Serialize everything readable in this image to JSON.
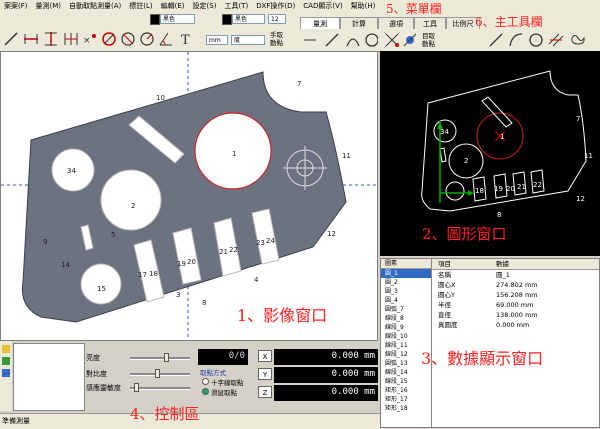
{
  "menu": [
    "案案(F)",
    "量測(M)",
    "自動取點測量(A)",
    "標註(L)",
    "編輯(E)",
    "設定(S)",
    "工具(T)",
    "DXF操作(D)",
    "CAD顯示(V)",
    "幫助(H)"
  ],
  "toolbar": {
    "color1": "黑色",
    "color2": "黑色",
    "line_width": "12",
    "unit_combo": "mm",
    "angle_combo": "度",
    "manual_pick": [
      "手取",
      "動點"
    ],
    "auto_pick": [
      "目取",
      "動點"
    ]
  },
  "tabs": [
    {
      "label": "量測",
      "active": true
    },
    {
      "label": "計算",
      "active": false
    },
    {
      "label": "選項",
      "active": false
    },
    {
      "label": "工具",
      "active": false
    },
    {
      "label": "比例尺",
      "active": false
    }
  ],
  "image_window": {
    "part_labels": [
      "1",
      "2",
      "3",
      "4",
      "5",
      "7",
      "8",
      "9",
      "10",
      "11",
      "12",
      "14",
      "15",
      "17",
      "18",
      "19",
      "20",
      "21",
      "22",
      "23",
      "24",
      "34"
    ]
  },
  "graphics_window": {
    "part_labels": [
      "1",
      "2",
      "7",
      "8",
      "11",
      "12",
      "18",
      "19",
      "20",
      "21",
      "22",
      "34"
    ]
  },
  "data_window": {
    "list_header": "圖素",
    "list_items": [
      {
        "label": "圓_1",
        "selected": true
      },
      {
        "label": "圓_2",
        "selected": false
      },
      {
        "label": "圓_3",
        "selected": false
      },
      {
        "label": "圓_4",
        "selected": false
      },
      {
        "label": "圓弧_7",
        "selected": false
      },
      {
        "label": "線段_8",
        "selected": false
      },
      {
        "label": "線段_9",
        "selected": false
      },
      {
        "label": "線段_10",
        "selected": false
      },
      {
        "label": "線段_11",
        "selected": false
      },
      {
        "label": "線段_12",
        "selected": false
      },
      {
        "label": "圓弧_13",
        "selected": false
      },
      {
        "label": "線段_14",
        "selected": false
      },
      {
        "label": "線段_15",
        "selected": false
      },
      {
        "label": "矩形_16",
        "selected": false
      },
      {
        "label": "矩形_17",
        "selected": false
      },
      {
        "label": "矩形_18",
        "selected": false
      }
    ],
    "prop_header": {
      "key": "項目",
      "value": "數據"
    },
    "props": [
      {
        "key": "名稱",
        "value": "圓_1"
      },
      {
        "key": "圓心X",
        "value": "274.802 mm"
      },
      {
        "key": "圓心Y",
        "value": "156.208 mm"
      },
      {
        "key": "半徑",
        "value": "69.000 mm"
      },
      {
        "key": "直徑",
        "value": "138.000 mm"
      },
      {
        "key": "真圓度",
        "value": "0.000 mm"
      }
    ]
  },
  "control": {
    "brightness_label": "亮度",
    "contrast_label": "對比度",
    "sensitivity_label": "感應靈敏度",
    "brightness": 0.62,
    "contrast": 0.45,
    "sensitivity": 0.08,
    "counter": "0/0",
    "pick_mode_title": "取點方式",
    "pick_mode_options": [
      "十字線取點",
      "滑鼠取點"
    ],
    "axes": [
      {
        "axis": "X",
        "value": "0.000 mm"
      },
      {
        "axis": "Y",
        "value": "0.000 mm"
      },
      {
        "axis": "Z",
        "value": "0.000 mm"
      }
    ],
    "status": "準備測量"
  },
  "annotations": {
    "menu": "5、菜單欄",
    "toolbar": "6、主工具欄",
    "image": "1、影像窗口",
    "graphics": "2、圖形窗口",
    "data": "3、數據顯示窗口",
    "control": "4、控制區"
  },
  "colors": {
    "annot": "#ff2222",
    "part": "#6d7280",
    "selected_circle": "#cc2222",
    "readout_bg": "#000000"
  }
}
